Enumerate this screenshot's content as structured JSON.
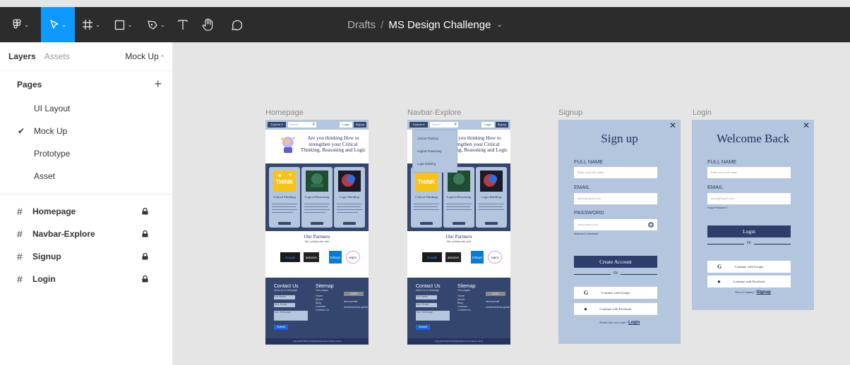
{
  "toolbar": {
    "title_drafts": "Drafts",
    "title_sep": "/",
    "title_file": "MS Design Challenge"
  },
  "sidebar": {
    "tab_layers": "Layers",
    "tab_assets": "Assets",
    "current_page": "Mock Up",
    "pages_heading": "Pages",
    "pages": [
      "UI Layout",
      "Mock Up",
      "Prototype",
      "Asset"
    ],
    "selected_page_index": 1,
    "layers": [
      "Homepage",
      "Navbar-Explore",
      "Signup",
      "Login"
    ]
  },
  "canvas": {
    "frames": [
      "Homepage",
      "Navbar-Explore",
      "Signup",
      "Login"
    ],
    "homepage": {
      "explore": "Explore ▾",
      "search": "Search",
      "login": "Login",
      "signup": "Signup",
      "hero": "Are you thinking How to strengthen your Critical Thinking, Reasoning and Logic",
      "cards": [
        "Critical Thinking",
        "Logical Reasoning",
        "Logic Building"
      ],
      "partners_title": "Our Partners",
      "partners_sub": "We collaborate with",
      "partner_logos": [
        "Google",
        "amazon",
        "Infosys",
        "wipro"
      ],
      "contact_title": "Contact Us",
      "contact_sub": "send us a message",
      "fields": [
        "Full Name",
        "Your Email",
        "Your Message"
      ],
      "submit": "Submit",
      "sitemap_title": "Sitemap",
      "sitemap_sub": "Our pages",
      "sitemap_links": [
        "Home",
        "About",
        "Blog",
        "Courses",
        "Contact Us"
      ],
      "logo": "LOGO",
      "phone": "abc/xyz/will",
      "email": "email/address.gmail",
      "copyright": "Copyright©2023 All Right Reserved company name"
    },
    "dropdown_items": [
      "Critical Thinking",
      "Logical Reasoning",
      "Logic Building"
    ],
    "signup": {
      "title": "Sign up",
      "full_name_label": "FULL NAME",
      "full_name_placeholder": "Enter your full name",
      "email_label": "EMAIL",
      "email_placeholder": "name@email.com",
      "password_label": "PASSWORD",
      "password_placeholder": "create password",
      "hint": "Minimum 8 characters",
      "create": "Create Account",
      "or": "Or",
      "google": "Continue with Google",
      "facebook": "Continue with Facebook",
      "footer_text": "Already have an account ?",
      "footer_link": "Login"
    },
    "login": {
      "title": "Welcome Back",
      "full_name_label": "FULL NAME",
      "full_name_placeholder": "Enter your full name",
      "email_label": "EMAIL",
      "email_placeholder": "name@email.com",
      "forgot": "Forgot Password ?",
      "login": "Login",
      "or": "Or",
      "google": "Continue with Google",
      "facebook": "Continue with Facebook",
      "footer_text": "New to Company ?",
      "footer_link": "Signup"
    }
  },
  "colors": {
    "toolbar": "#2c2c2c",
    "active_tool": "#0d99ff",
    "canvas": "#e5e5e5",
    "navy": "#34456e",
    "light_blue": "#b3c6de"
  }
}
